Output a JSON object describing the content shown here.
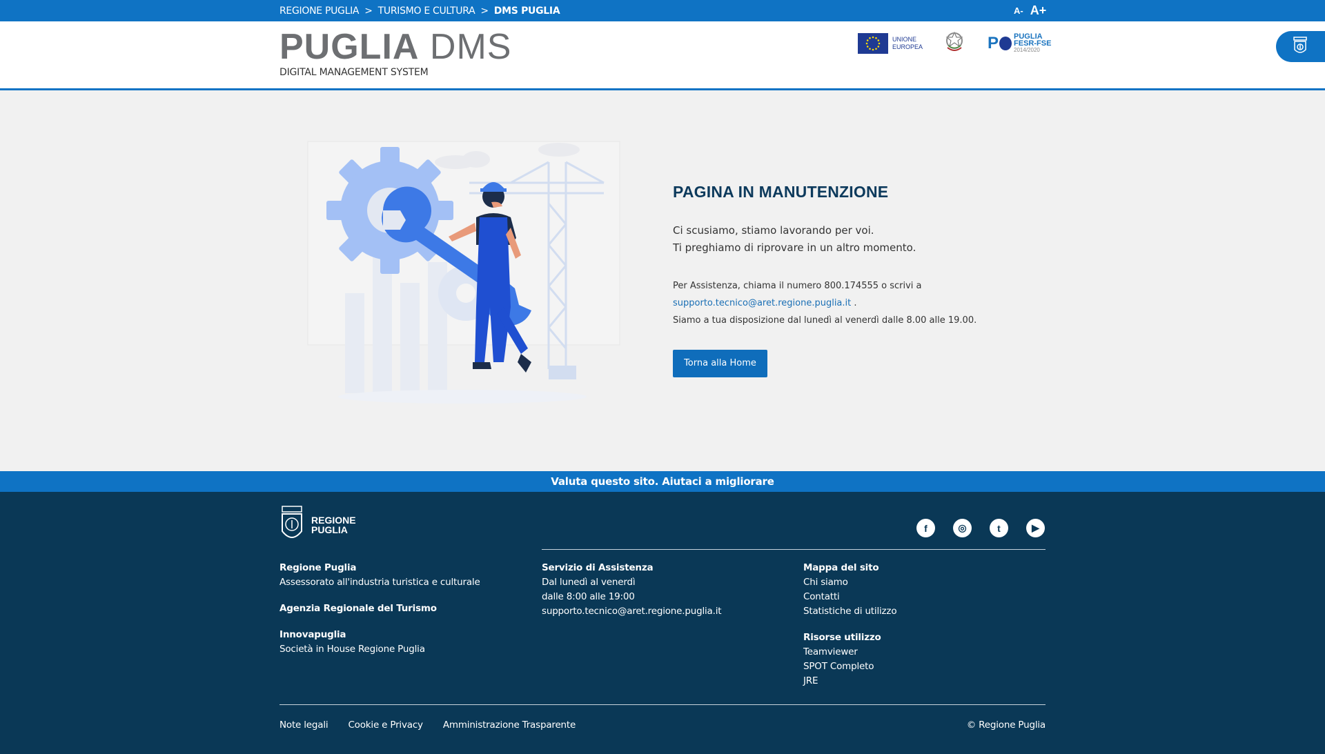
{
  "topbar": {
    "breadcrumb": [
      "REGIONE PUGLIA",
      "TURISMO E CULTURA",
      "DMS PUGLIA"
    ],
    "separator": ">",
    "font_decrease": "A-",
    "font_increase": "A+"
  },
  "header": {
    "title_bold": "PUGLIA",
    "title_light": "DMS",
    "subtitle": "DIGITAL MANAGEMENT SYSTEM",
    "eu_logo_text": [
      "UNIONE",
      "EUROPEA"
    ],
    "pfesr_text": [
      "PUGLIA",
      "FESR-FSE",
      "2014/2020"
    ],
    "pfesr_letter": "P"
  },
  "main": {
    "title": "PAGINA IN MANUTENZIONE",
    "message_line1": "Ci scusiamo, stiamo lavorando per voi.",
    "message_line2": "Ti preghiamo di riprovare in un altro momento.",
    "assist_line1": "Per Assistenza, chiama il numero 800.174555 o scrivi a",
    "assist_email": "supporto.tecnico@aret.regione.puglia.it",
    "assist_period": ".",
    "assist_line3": "Siamo a tua disposizione dal lunedì al venerdì dalle 8.00 alle 19.00.",
    "home_button": "Torna alla Home"
  },
  "ratebar": {
    "label": "Valuta questo sito. Aiutaci a migliorare"
  },
  "footer": {
    "logo_text": [
      "REGIONE",
      "PUGLIA"
    ],
    "socials": [
      {
        "icon": "facebook-icon",
        "glyph": "f"
      },
      {
        "icon": "instagram-icon",
        "glyph": "◎"
      },
      {
        "icon": "twitter-icon",
        "glyph": "t"
      },
      {
        "icon": "youtube-icon",
        "glyph": "▶"
      }
    ],
    "col1": [
      {
        "title": "Regione Puglia",
        "text": "Assessorato all'industria turistica e culturale"
      },
      {
        "title": "Agenzia Regionale del Turismo",
        "text": ""
      },
      {
        "title": "Innovapuglia",
        "text": "Società in House Regione Puglia"
      }
    ],
    "col2": {
      "title": "Servizio di Assistenza",
      "lines": [
        "Dal lunedì al venerdì",
        "dalle 8:00 alle 19:00",
        "supporto.tecnico@aret.regione.puglia.it"
      ]
    },
    "col3": [
      {
        "title": "Mappa del sito",
        "links": [
          "Chi siamo",
          "Contatti",
          "Statistiche di utilizzo"
        ]
      },
      {
        "title": "Risorse utilizzo",
        "links": [
          "Teamviewer",
          "SPOT Completo",
          "JRE"
        ]
      }
    ],
    "bottom_links": [
      "Note legali",
      "Cookie e Privacy",
      "Amministrazione Trasparente"
    ],
    "copyright": "© Regione Puglia"
  },
  "colors": {
    "primary": "#0f73c4",
    "footer_bg": "#0a3856",
    "title": "#0d3a5c",
    "page_bg": "#f1f1f1"
  }
}
